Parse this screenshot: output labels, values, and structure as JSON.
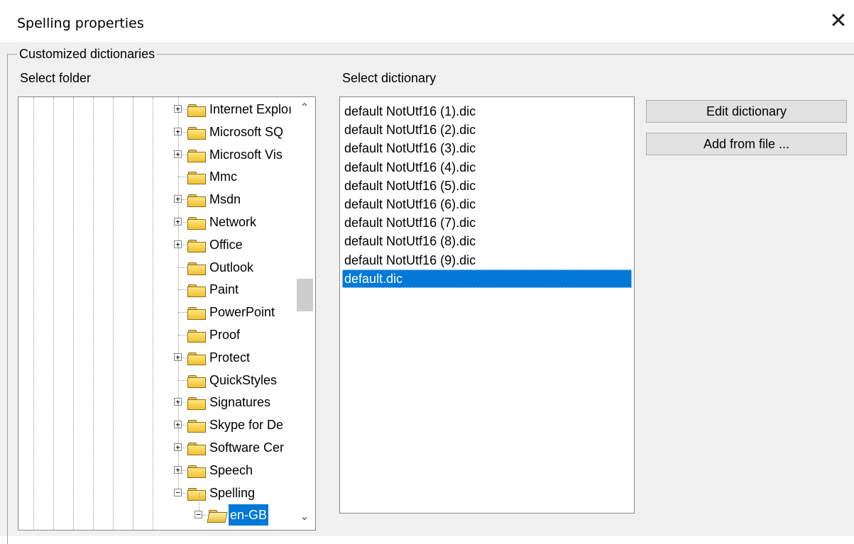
{
  "window": {
    "title": "Spelling properties",
    "close_glyph": "✕"
  },
  "group": {
    "legend": "Customized dictionaries",
    "select_folder_label": "Select folder",
    "select_dictionary_label": "Select dictionary"
  },
  "tree": {
    "items": [
      {
        "label": "Internet Exploı",
        "expander": "+"
      },
      {
        "label": "Microsoft SQ",
        "expander": "+"
      },
      {
        "label": "Microsoft Vis",
        "expander": "+"
      },
      {
        "label": "Mmc",
        "expander": ""
      },
      {
        "label": "Msdn",
        "expander": "+"
      },
      {
        "label": "Network",
        "expander": "+"
      },
      {
        "label": "Office",
        "expander": "+"
      },
      {
        "label": "Outlook",
        "expander": ""
      },
      {
        "label": "Paint",
        "expander": ""
      },
      {
        "label": "PowerPoint",
        "expander": ""
      },
      {
        "label": "Proof",
        "expander": ""
      },
      {
        "label": "Protect",
        "expander": "+"
      },
      {
        "label": "QuickStyles",
        "expander": ""
      },
      {
        "label": "Signatures",
        "expander": "+"
      },
      {
        "label": "Skype for De",
        "expander": "+"
      },
      {
        "label": "Software Cer",
        "expander": "+"
      },
      {
        "label": "Speech",
        "expander": "+"
      },
      {
        "label": "Spelling",
        "expander": "−"
      },
      {
        "label": "en-GB",
        "expander": "−",
        "selected": true
      }
    ],
    "scroll_up_glyph": "⌃",
    "scroll_down_glyph": "⌄"
  },
  "dictionaries": {
    "items": [
      "default NotUtf16 (1).dic",
      "default NotUtf16 (2).dic",
      "default NotUtf16 (3).dic",
      "default NotUtf16 (4).dic",
      "default NotUtf16 (5).dic",
      "default NotUtf16 (6).dic",
      "default NotUtf16 (7).dic",
      "default NotUtf16 (8).dic",
      "default NotUtf16 (9).dic",
      "default.dic"
    ],
    "selected_index": 9
  },
  "buttons": {
    "edit_dictionary": "Edit dictionary",
    "add_from_file": "Add from file ..."
  },
  "colors": {
    "selection": "#0078d7",
    "dialog_bg": "#f0f0f0"
  }
}
